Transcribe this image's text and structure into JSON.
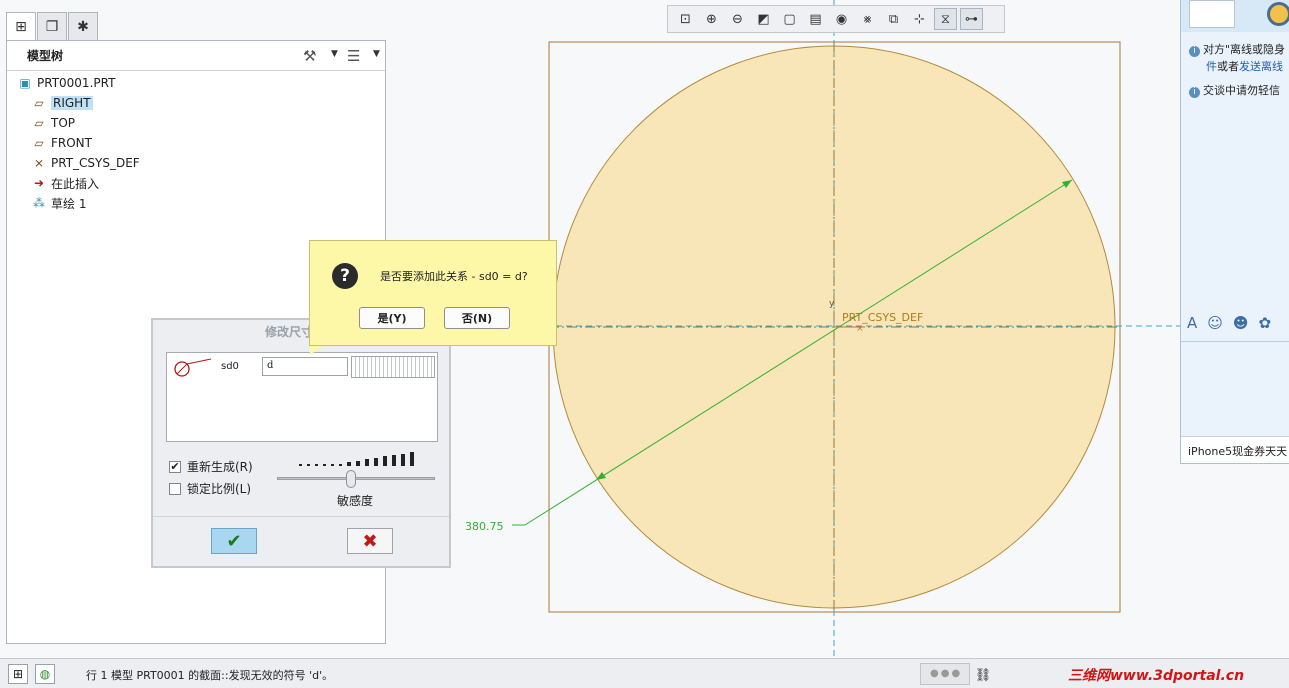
{
  "left_tabs": [
    {
      "icon": "model-tree-icon",
      "glyph": "⊞"
    },
    {
      "icon": "folder-browser-icon",
      "glyph": "❐"
    },
    {
      "icon": "favorites-icon",
      "glyph": "✱"
    }
  ],
  "model_tree": {
    "title": "模型树",
    "settings_icon": "tools-icon",
    "show_icon": "list-icon",
    "items": [
      {
        "label": "PRT0001.PRT",
        "icon": "part-icon",
        "glyph": "▣",
        "indent": 0,
        "selected": false
      },
      {
        "label": "RIGHT",
        "icon": "datum-plane-icon",
        "glyph": "▱",
        "indent": 1,
        "selected": true
      },
      {
        "label": "TOP",
        "icon": "datum-plane-icon",
        "glyph": "▱",
        "indent": 1,
        "selected": false
      },
      {
        "label": "FRONT",
        "icon": "datum-plane-icon",
        "glyph": "▱",
        "indent": 1,
        "selected": false
      },
      {
        "label": "PRT_CSYS_DEF",
        "icon": "coordinate-system-icon",
        "glyph": "⨯",
        "indent": 1,
        "selected": false
      },
      {
        "label": "在此插入",
        "icon": "insert-arrow-icon",
        "glyph": "➜",
        "indent": 1,
        "selected": false
      },
      {
        "label": "草绘 1",
        "icon": "sketch-icon",
        "glyph": "⁂",
        "indent": 1,
        "selected": false
      }
    ]
  },
  "view_toolbar": [
    {
      "icon": "refit-icon",
      "glyph": "⊡",
      "active": false
    },
    {
      "icon": "zoom-in-icon",
      "glyph": "⊕",
      "active": false
    },
    {
      "icon": "zoom-out-icon",
      "glyph": "⊖",
      "active": false
    },
    {
      "icon": "repaint-icon",
      "glyph": "◩",
      "active": false
    },
    {
      "icon": "shading-icon",
      "glyph": "▢",
      "active": false
    },
    {
      "icon": "saved-views-icon",
      "glyph": "▤",
      "active": false
    },
    {
      "icon": "camera-icon",
      "glyph": "◉",
      "active": false
    },
    {
      "icon": "datum-display-icon",
      "glyph": "⨳",
      "active": false
    },
    {
      "icon": "sketch-view-icon",
      "glyph": "⧉",
      "active": false
    },
    {
      "icon": "dimension-display-icon",
      "glyph": "⊹",
      "active": false
    },
    {
      "icon": "constraint-display-icon",
      "glyph": "⧖",
      "active": true
    },
    {
      "icon": "vertex-display-icon",
      "glyph": "⊶",
      "active": true
    }
  ],
  "canvas": {
    "csys_label": "PRT_CSYS_DEF",
    "y_axis_label": "y",
    "dimension_value": "380.75",
    "colors": {
      "circle_fill": "#f9e6b8",
      "circle_stroke": "#b28a3a",
      "frame": "#a8743a",
      "centerline": "#3aa8c8",
      "dimension": "#32b032"
    }
  },
  "modify_dialog": {
    "title": "修改尺寸",
    "dimension_name": "sd0",
    "dimension_value": "d",
    "regenerate_label": "重新生成(R)",
    "regenerate_checked": true,
    "lock_scale_label": "锁定比例(L)",
    "lock_scale_checked": false,
    "sensitivity_label": "敏感度",
    "sensitivity_level": 0.5,
    "ok_glyph": "✔",
    "cancel_glyph": "✖"
  },
  "confirm_dialog": {
    "message": "是否要添加此关系 - sd0 = d?",
    "yes_label": "是(Y)",
    "no_label": "否(N)",
    "icon_glyph": "?"
  },
  "chat_panel": {
    "notice1_a": "对方\"离线或隐身",
    "notice1_b_link": "件",
    "notice1_b_text": "或者",
    "notice1_b_link2": "发送离线",
    "notice2": "交谈中请勿轻信",
    "ad_text": "iPhone5现金券天天",
    "tool_icons": [
      {
        "icon": "font-icon",
        "glyph": "A"
      },
      {
        "icon": "emoji-icon",
        "glyph": "☺"
      },
      {
        "icon": "vip-emoji-icon",
        "glyph": "☻"
      },
      {
        "icon": "sticker-icon",
        "glyph": "✿"
      }
    ]
  },
  "status_bar": {
    "message": "行 1 模型 PRT0001 的截面::发现无效的符号 'd'。",
    "watermark": "三维网www.3dportal.cn"
  }
}
